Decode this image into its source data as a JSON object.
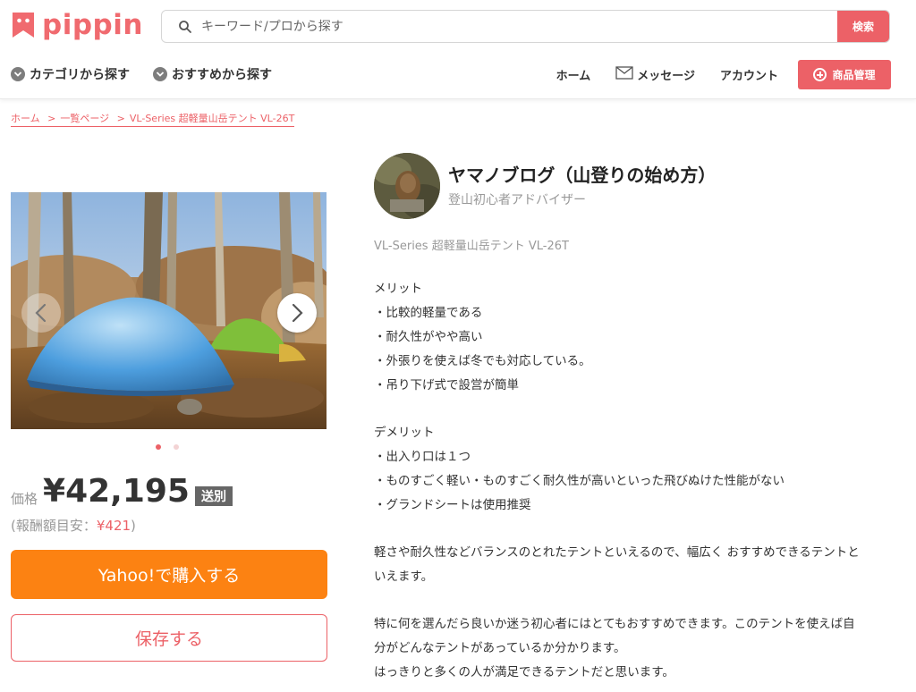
{
  "header": {
    "logo_text": "pippin",
    "search_placeholder": "キーワード/プロから探す",
    "search_button": "検索",
    "nav_category": "カテゴリから探す",
    "nav_recommend": "おすすめから探す",
    "nav_home": "ホーム",
    "nav_message": "メッセージ",
    "nav_account": "アカウント",
    "manage_button": "商品管理"
  },
  "breadcrumb": {
    "home": "ホーム",
    "list": "一覧ページ",
    "current": "VL-Series 超軽量山岳テント VL-26T",
    "separator": ">"
  },
  "slider": {
    "image": "tent-in-forest-photo",
    "dot_count": 2,
    "active_dot": 0
  },
  "price": {
    "label": "価格",
    "value": "¥42,195",
    "shipping": "送別",
    "reward_prefix": "(報酬額目安：",
    "reward_amount": "¥421",
    "reward_suffix": ")"
  },
  "buttons": {
    "buy": "Yahoo!で購入する",
    "save": "保存する"
  },
  "author": {
    "name": "ヤマノブログ（山登りの始め方）",
    "role": "登山初心者アドバイザー"
  },
  "product_name": "VL-Series 超軽量山岳テント VL-26T",
  "description": {
    "merit_heading": "メリット",
    "merits": [
      "・比較的軽量である",
      "・耐久性がやや高い",
      "・外張りを使えば冬でも対応している。",
      "・吊り下げ式で設営が簡単"
    ],
    "demerit_heading": "デメリット",
    "demerits": [
      "・出入り口は１つ",
      "・ものすごく軽い・ものすごく耐久性が高いといった飛びぬけた性能がない",
      "・グランドシートは使用推奨"
    ],
    "para1_line1": "軽さや耐久性などバランスのとれたテントといえるので、幅広く おすすめできるテントと",
    "para1_line2": "いえます。",
    "para2_line1": "特に何を選んだら良いか迷う初心者にはとてもおすすめできます。このテントを使えば自",
    "para2_line2": "分がどんなテントがあっているか分かります。",
    "para2_line3": "はっきりと多くの人が満足できるテントだと思います。"
  },
  "colors": {
    "brand": "#ec6167",
    "buy_button": "#fc8212"
  }
}
